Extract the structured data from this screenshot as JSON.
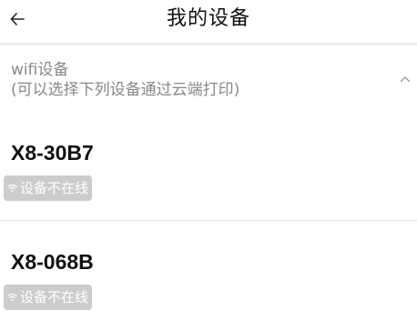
{
  "header": {
    "title": "我的设备",
    "back_icon": "arrow-left-icon"
  },
  "section": {
    "title": "wifi设备",
    "subtitle": "(可以选择下列设备通过云端打印)",
    "toggle_icon": "chevron-up-icon"
  },
  "devices": [
    {
      "name": "X8-30B7",
      "status": "设备不在线",
      "status_icon": "wifi-icon"
    },
    {
      "name": "X8-068B",
      "status": "设备不在线",
      "status_icon": "wifi-icon"
    }
  ],
  "colors": {
    "badge_bg": "#cccccc",
    "muted_text": "#888888",
    "divider": "#e6e6e6"
  }
}
